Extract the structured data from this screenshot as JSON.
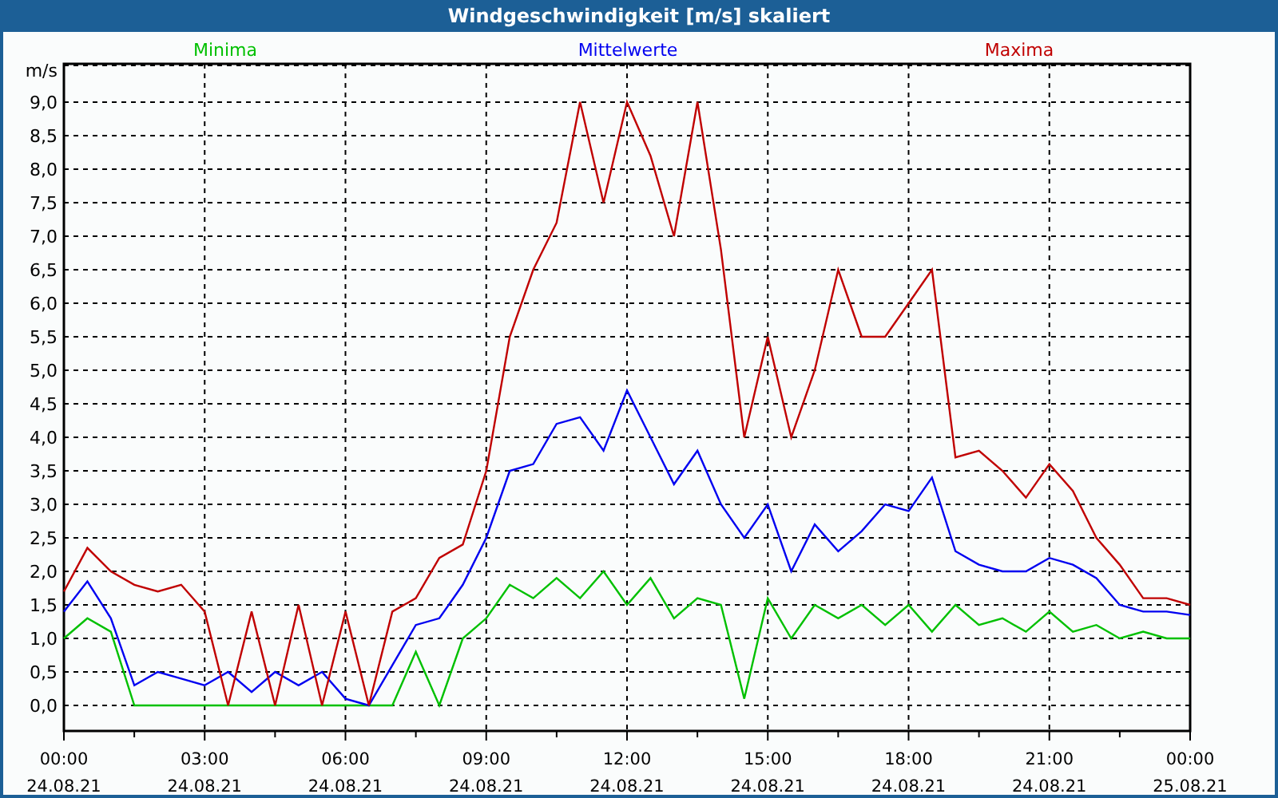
{
  "window": {
    "title": "Windgeschwindigkeit [m/s] skaliert"
  },
  "chart": {
    "chart_data": {
      "type": "line",
      "grid": true,
      "ylabel": "m/s",
      "ylim": [
        -0.38,
        9.57
      ],
      "categories": [
        "00:00 24.08.21",
        null,
        null,
        null,
        null,
        null,
        "03:00 24.08.21",
        null,
        null,
        null,
        null,
        null,
        "06:00 24.08.21",
        null,
        null,
        null,
        null,
        null,
        "09:00 24.08.21",
        null,
        null,
        null,
        null,
        null,
        "12:00 24.08.21",
        null,
        null,
        null,
        null,
        null,
        "15:00 24.08.21",
        null,
        null,
        null,
        null,
        null,
        "18:00 24.08.21",
        null,
        null,
        null,
        null,
        null,
        "21:00 24.08.21",
        null,
        null,
        null,
        null,
        null,
        "00:00 25.08.21"
      ],
      "yticks": [
        {
          "value": 0,
          "label": "0,0"
        },
        {
          "value": 0.5,
          "label": "0,5"
        },
        {
          "value": 1,
          "label": "1,0"
        },
        {
          "value": 1.5,
          "label": "1,5"
        },
        {
          "value": 2,
          "label": "2,0"
        },
        {
          "value": 2.5,
          "label": "2,5"
        },
        {
          "value": 3,
          "label": "3,0"
        },
        {
          "value": 3.5,
          "label": "3,5"
        },
        {
          "value": 4,
          "label": "4,0"
        },
        {
          "value": 4.5,
          "label": "4,5"
        },
        {
          "value": 5,
          "label": "5,0"
        },
        {
          "value": 5.5,
          "label": "5,5"
        },
        {
          "value": 6,
          "label": "6,0"
        },
        {
          "value": 6.5,
          "label": "6,5"
        },
        {
          "value": 7,
          "label": "7,0"
        },
        {
          "value": 7.5,
          "label": "7,5"
        },
        {
          "value": 8,
          "label": "8,0"
        },
        {
          "value": 8.5,
          "label": "8,5"
        },
        {
          "value": 9,
          "label": "9,0"
        }
      ],
      "series": [
        {
          "name": "Minima",
          "color": "#00c000",
          "values": [
            1.0,
            1.3,
            1.1,
            0,
            0,
            0,
            0,
            0,
            0,
            0,
            0,
            0,
            0,
            0,
            0,
            0.8,
            0,
            1.0,
            1.3,
            1.8,
            1.6,
            1.9,
            1.6,
            2.0,
            1.5,
            1.9,
            1.3,
            1.6,
            1.5,
            0.1,
            1.6,
            1.0,
            1.5,
            1.3,
            1.5,
            1.2,
            1.5,
            1.1,
            1.5,
            1.2,
            1.3,
            1.1,
            1.4,
            1.1,
            1.2,
            1.0,
            1.1,
            1.0,
            1.0
          ]
        },
        {
          "name": "Mittelwerte",
          "color": "#0000f0",
          "values": [
            1.4,
            1.85,
            1.3,
            0.3,
            0.5,
            0.4,
            0.3,
            0.5,
            0.2,
            0.5,
            0.3,
            0.5,
            0.1,
            0,
            0.6,
            1.2,
            1.3,
            1.8,
            2.5,
            3.5,
            3.6,
            4.2,
            4.3,
            3.8,
            4.7,
            4.0,
            3.3,
            3.8,
            3.0,
            2.5,
            3.0,
            2.0,
            2.7,
            2.3,
            2.6,
            3.0,
            2.9,
            3.4,
            2.3,
            2.1,
            2.0,
            2.0,
            2.2,
            2.1,
            1.9,
            1.5,
            1.4,
            1.4,
            1.35
          ]
        },
        {
          "name": "Maxima",
          "color": "#c00000",
          "values": [
            1.7,
            2.35,
            2.0,
            1.8,
            1.7,
            1.8,
            1.4,
            0,
            1.4,
            0,
            1.5,
            0,
            1.4,
            0,
            1.4,
            1.6,
            2.2,
            2.4,
            3.5,
            5.5,
            6.5,
            7.2,
            9.0,
            7.5,
            9.0,
            8.2,
            7.0,
            9.0,
            6.8,
            4.0,
            5.5,
            4.0,
            5.0,
            6.5,
            5.5,
            5.5,
            6.0,
            6.5,
            3.7,
            3.8,
            3.5,
            3.1,
            3.6,
            3.2,
            2.5,
            2.1,
            1.6,
            1.6,
            1.5
          ]
        }
      ]
    }
  }
}
